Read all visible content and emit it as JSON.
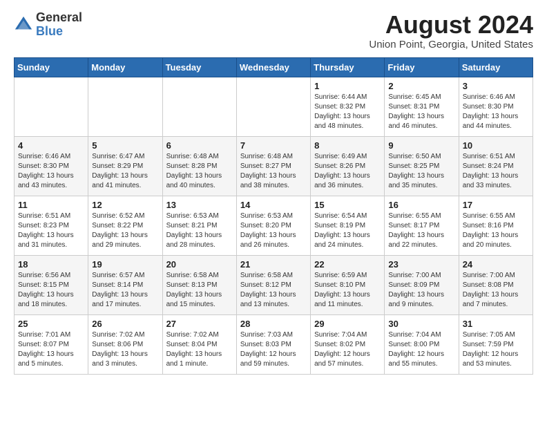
{
  "header": {
    "logo": {
      "line1": "General",
      "line2": "Blue"
    },
    "title": "August 2024",
    "location": "Union Point, Georgia, United States"
  },
  "weekdays": [
    "Sunday",
    "Monday",
    "Tuesday",
    "Wednesday",
    "Thursday",
    "Friday",
    "Saturday"
  ],
  "weeks": [
    [
      {
        "day": "",
        "info": ""
      },
      {
        "day": "",
        "info": ""
      },
      {
        "day": "",
        "info": ""
      },
      {
        "day": "",
        "info": ""
      },
      {
        "day": "1",
        "info": "Sunrise: 6:44 AM\nSunset: 8:32 PM\nDaylight: 13 hours\nand 48 minutes."
      },
      {
        "day": "2",
        "info": "Sunrise: 6:45 AM\nSunset: 8:31 PM\nDaylight: 13 hours\nand 46 minutes."
      },
      {
        "day": "3",
        "info": "Sunrise: 6:46 AM\nSunset: 8:30 PM\nDaylight: 13 hours\nand 44 minutes."
      }
    ],
    [
      {
        "day": "4",
        "info": "Sunrise: 6:46 AM\nSunset: 8:30 PM\nDaylight: 13 hours\nand 43 minutes."
      },
      {
        "day": "5",
        "info": "Sunrise: 6:47 AM\nSunset: 8:29 PM\nDaylight: 13 hours\nand 41 minutes."
      },
      {
        "day": "6",
        "info": "Sunrise: 6:48 AM\nSunset: 8:28 PM\nDaylight: 13 hours\nand 40 minutes."
      },
      {
        "day": "7",
        "info": "Sunrise: 6:48 AM\nSunset: 8:27 PM\nDaylight: 13 hours\nand 38 minutes."
      },
      {
        "day": "8",
        "info": "Sunrise: 6:49 AM\nSunset: 8:26 PM\nDaylight: 13 hours\nand 36 minutes."
      },
      {
        "day": "9",
        "info": "Sunrise: 6:50 AM\nSunset: 8:25 PM\nDaylight: 13 hours\nand 35 minutes."
      },
      {
        "day": "10",
        "info": "Sunrise: 6:51 AM\nSunset: 8:24 PM\nDaylight: 13 hours\nand 33 minutes."
      }
    ],
    [
      {
        "day": "11",
        "info": "Sunrise: 6:51 AM\nSunset: 8:23 PM\nDaylight: 13 hours\nand 31 minutes."
      },
      {
        "day": "12",
        "info": "Sunrise: 6:52 AM\nSunset: 8:22 PM\nDaylight: 13 hours\nand 29 minutes."
      },
      {
        "day": "13",
        "info": "Sunrise: 6:53 AM\nSunset: 8:21 PM\nDaylight: 13 hours\nand 28 minutes."
      },
      {
        "day": "14",
        "info": "Sunrise: 6:53 AM\nSunset: 8:20 PM\nDaylight: 13 hours\nand 26 minutes."
      },
      {
        "day": "15",
        "info": "Sunrise: 6:54 AM\nSunset: 8:19 PM\nDaylight: 13 hours\nand 24 minutes."
      },
      {
        "day": "16",
        "info": "Sunrise: 6:55 AM\nSunset: 8:17 PM\nDaylight: 13 hours\nand 22 minutes."
      },
      {
        "day": "17",
        "info": "Sunrise: 6:55 AM\nSunset: 8:16 PM\nDaylight: 13 hours\nand 20 minutes."
      }
    ],
    [
      {
        "day": "18",
        "info": "Sunrise: 6:56 AM\nSunset: 8:15 PM\nDaylight: 13 hours\nand 18 minutes."
      },
      {
        "day": "19",
        "info": "Sunrise: 6:57 AM\nSunset: 8:14 PM\nDaylight: 13 hours\nand 17 minutes."
      },
      {
        "day": "20",
        "info": "Sunrise: 6:58 AM\nSunset: 8:13 PM\nDaylight: 13 hours\nand 15 minutes."
      },
      {
        "day": "21",
        "info": "Sunrise: 6:58 AM\nSunset: 8:12 PM\nDaylight: 13 hours\nand 13 minutes."
      },
      {
        "day": "22",
        "info": "Sunrise: 6:59 AM\nSunset: 8:10 PM\nDaylight: 13 hours\nand 11 minutes."
      },
      {
        "day": "23",
        "info": "Sunrise: 7:00 AM\nSunset: 8:09 PM\nDaylight: 13 hours\nand 9 minutes."
      },
      {
        "day": "24",
        "info": "Sunrise: 7:00 AM\nSunset: 8:08 PM\nDaylight: 13 hours\nand 7 minutes."
      }
    ],
    [
      {
        "day": "25",
        "info": "Sunrise: 7:01 AM\nSunset: 8:07 PM\nDaylight: 13 hours\nand 5 minutes."
      },
      {
        "day": "26",
        "info": "Sunrise: 7:02 AM\nSunset: 8:06 PM\nDaylight: 13 hours\nand 3 minutes."
      },
      {
        "day": "27",
        "info": "Sunrise: 7:02 AM\nSunset: 8:04 PM\nDaylight: 13 hours\nand 1 minute."
      },
      {
        "day": "28",
        "info": "Sunrise: 7:03 AM\nSunset: 8:03 PM\nDaylight: 12 hours\nand 59 minutes."
      },
      {
        "day": "29",
        "info": "Sunrise: 7:04 AM\nSunset: 8:02 PM\nDaylight: 12 hours\nand 57 minutes."
      },
      {
        "day": "30",
        "info": "Sunrise: 7:04 AM\nSunset: 8:00 PM\nDaylight: 12 hours\nand 55 minutes."
      },
      {
        "day": "31",
        "info": "Sunrise: 7:05 AM\nSunset: 7:59 PM\nDaylight: 12 hours\nand 53 minutes."
      }
    ]
  ]
}
